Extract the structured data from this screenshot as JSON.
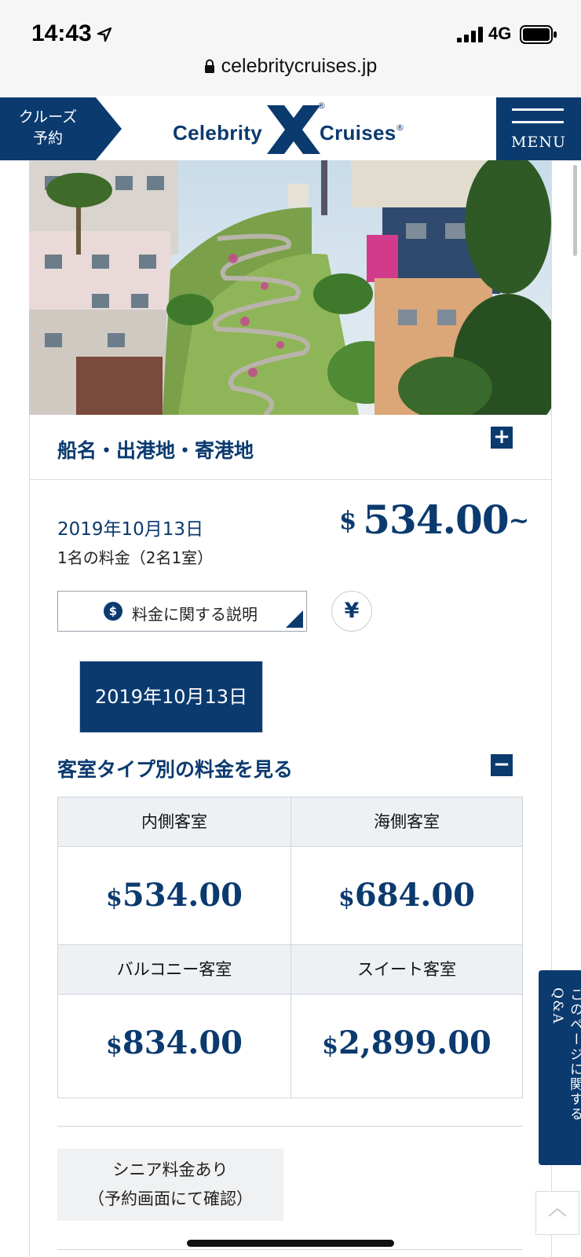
{
  "status_bar": {
    "time": "14:43",
    "network": "4G"
  },
  "browser": {
    "url": "celebritycruises.jp"
  },
  "header": {
    "book_label_line1": "クルーズ",
    "book_label_line2": "予約",
    "logo_left": "Celebrity",
    "logo_right": "Cruises",
    "logo_mark": "®",
    "menu_label": "MENU"
  },
  "hero": {
    "image": "lombard-street-photo"
  },
  "accordion": {
    "title": "船名・出港地・寄港地",
    "toggle": "+"
  },
  "price_summary": {
    "date": "2019年10月13日",
    "per_person": "1名の料金（2名1室）",
    "currency": "$",
    "amount": "534.00",
    "suffix": "~"
  },
  "fee_info": {
    "label": "料金に関する説明",
    "icon": "$"
  },
  "yen_toggle": "¥",
  "date_tab": "2019年10月13日",
  "room_section": {
    "title": "客室タイプ別の料金を見る",
    "toggle": "−"
  },
  "room_prices": [
    {
      "type": "内側客室",
      "currency": "$",
      "price": "534.00"
    },
    {
      "type": "海側客室",
      "currency": "$",
      "price": "684.00"
    },
    {
      "type": "バルコニー客室",
      "currency": "$",
      "price": "834.00"
    },
    {
      "type": "スイート客室",
      "currency": "$",
      "price": "2,899.00"
    }
  ],
  "senior": {
    "line1": "シニア料金あり",
    "line2": "（予約画面にて確認）"
  },
  "qa_tab": "このページに関するQ&A",
  "colors": {
    "brand_navy": "#0b3a6f",
    "border": "#cfd6dd",
    "cell_bg": "#eef1f4"
  }
}
